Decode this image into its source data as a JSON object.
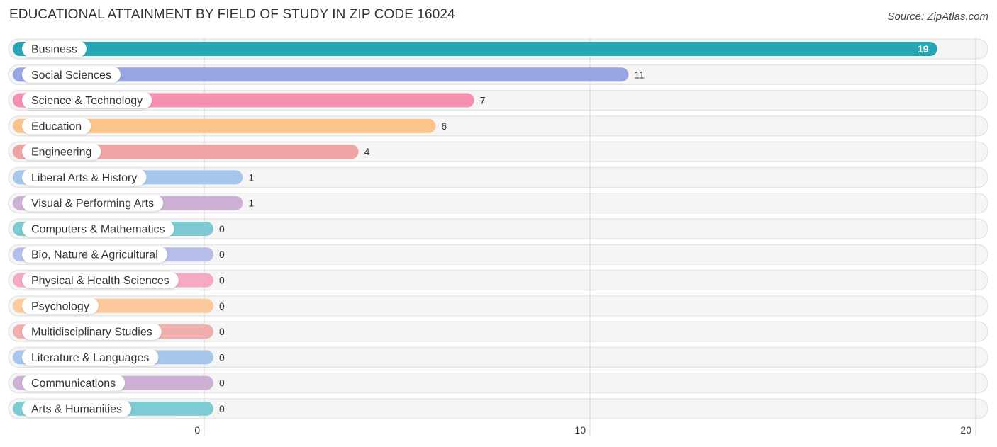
{
  "header": {
    "title": "EDUCATIONAL ATTAINMENT BY FIELD OF STUDY IN ZIP CODE 16024",
    "source": "Source: ZipAtlas.com"
  },
  "chart_data": {
    "type": "bar",
    "orientation": "horizontal",
    "title": "EDUCATIONAL ATTAINMENT BY FIELD OF STUDY IN ZIP CODE 16024",
    "xlabel": "",
    "ylabel": "",
    "xlim": [
      0,
      20
    ],
    "xticks": [
      0,
      10,
      20
    ],
    "xtick_labels": [
      "0",
      "10",
      "20"
    ],
    "grid": true,
    "categories": [
      "Business",
      "Social Sciences",
      "Science & Technology",
      "Education",
      "Engineering",
      "Liberal Arts & History",
      "Visual & Performing Arts",
      "Computers & Mathematics",
      "Bio, Nature & Agricultural",
      "Physical & Health Sciences",
      "Psychology",
      "Multidisciplinary Studies",
      "Literature & Languages",
      "Communications",
      "Arts & Humanities"
    ],
    "values": [
      19,
      11,
      7,
      6,
      4,
      1,
      1,
      0,
      0,
      0,
      0,
      0,
      0,
      0,
      0
    ],
    "value_labels": [
      "19",
      "11",
      "7",
      "6",
      "4",
      "1",
      "1",
      "0",
      "0",
      "0",
      "0",
      "0",
      "0",
      "0",
      "0"
    ],
    "colors": [
      "#26a6b5",
      "#98a5e2",
      "#f48fae",
      "#fbc48d",
      "#eea4a2",
      "#a6c6ec",
      "#ccb1d2",
      "#7dcad2",
      "#b5bdeb",
      "#f6a9c3",
      "#fbcb9e",
      "#f0aeac",
      "#a9c6ec",
      "#cdb1d5",
      "#7dccd4"
    ]
  }
}
